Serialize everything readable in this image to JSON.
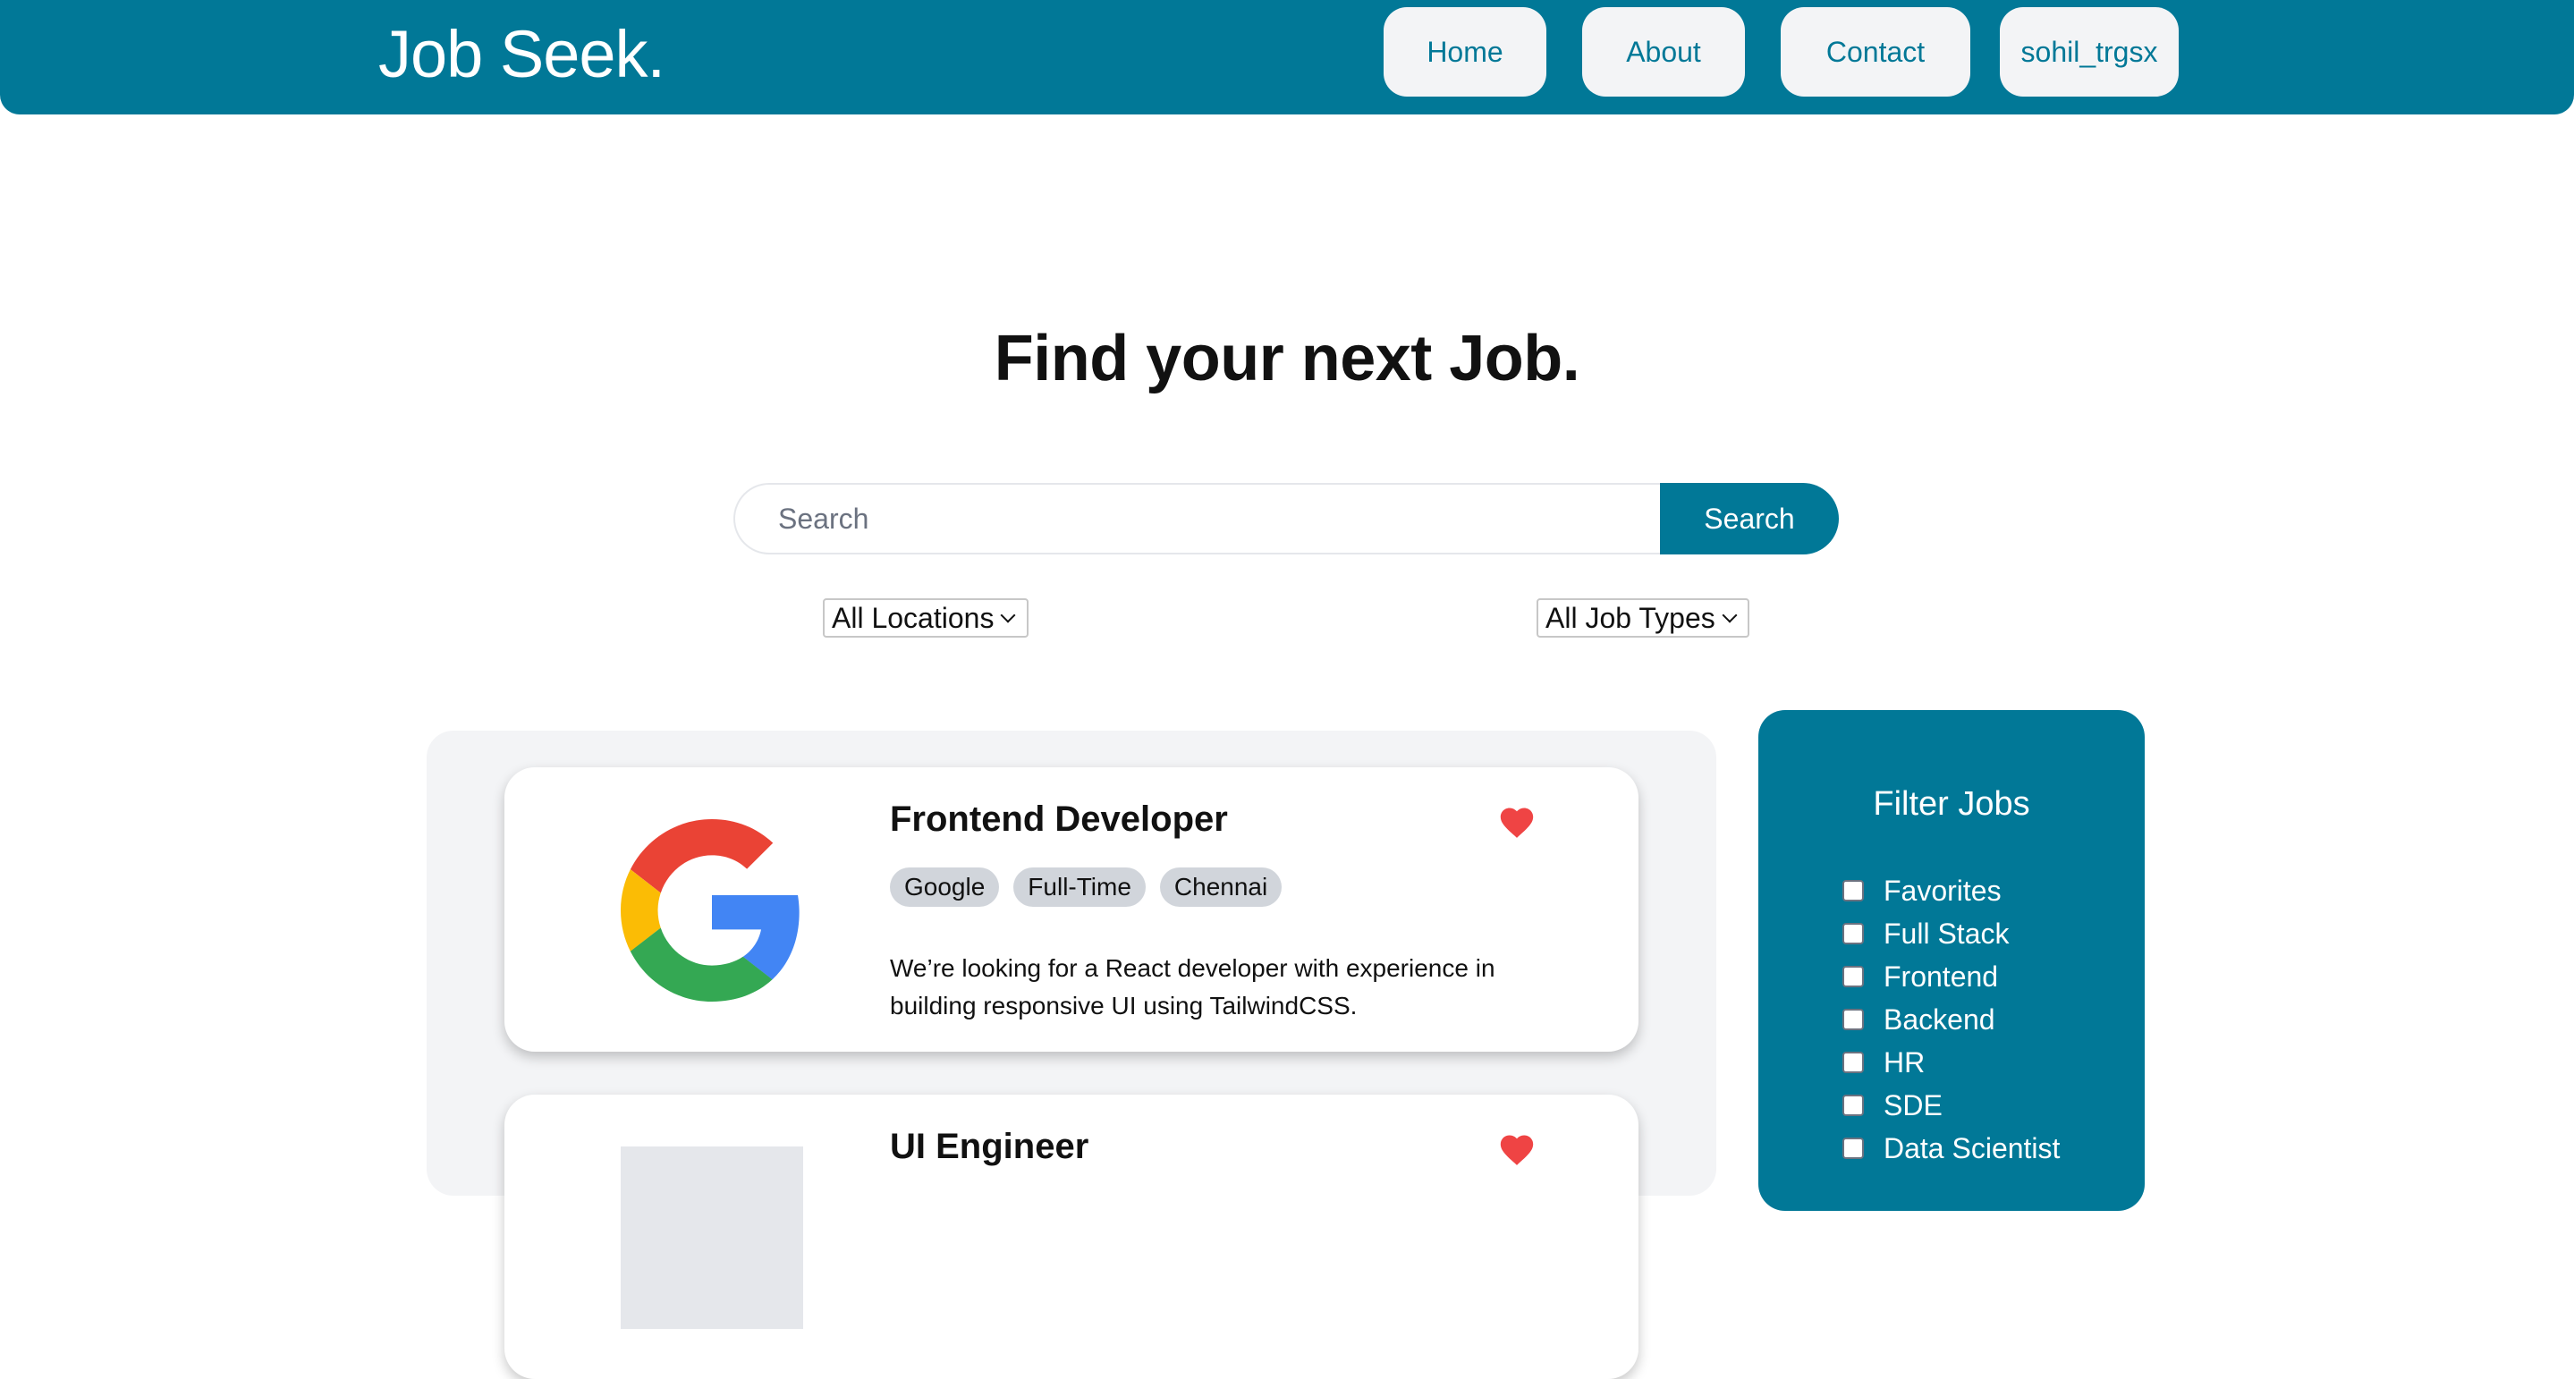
{
  "navbar": {
    "brand": "Job Seek.",
    "links": [
      "Home",
      "About",
      "Contact"
    ],
    "user": "sohil_trgsx",
    "accent_color": "#017897"
  },
  "hero": {
    "title": "Find your next Job.",
    "search_placeholder": "Search",
    "search_button": "Search",
    "location_select": "All Locations",
    "job_type_select": "All Job Types"
  },
  "jobs": [
    {
      "title": "Frontend Developer",
      "company": "Google",
      "type": "Full-Time",
      "location": "Chennai",
      "description": "We’re looking for a React developer with experience in building responsive UI using TailwindCSS.",
      "favorite": true,
      "logo_icon": "google-logo-icon"
    },
    {
      "title": "UI Engineer",
      "favorite": true
    }
  ],
  "filter": {
    "title": "Filter Jobs",
    "options": [
      "Favorites",
      "Full Stack",
      "Frontend",
      "Backend",
      "HR",
      "SDE",
      "Data Scientist"
    ]
  }
}
